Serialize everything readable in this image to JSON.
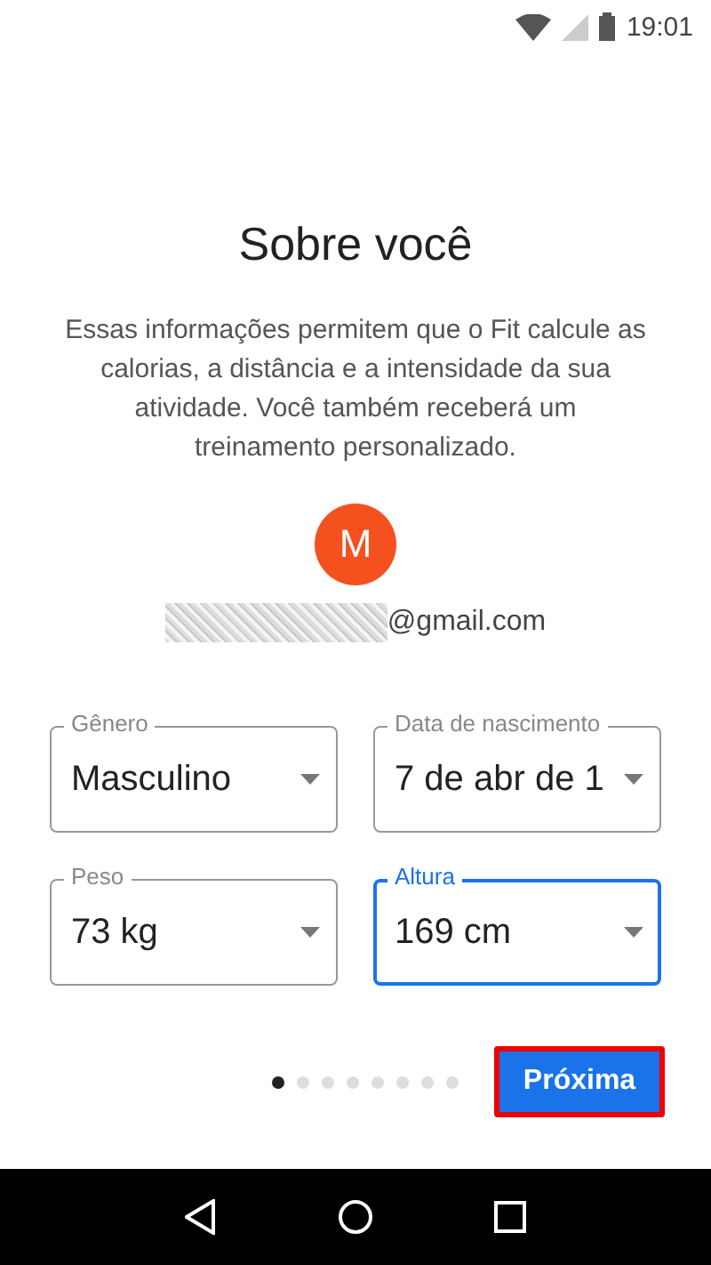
{
  "status_bar": {
    "time": "19:01"
  },
  "title": "Sobre você",
  "description": "Essas informações permitem que o Fit calcule as calorias, a distância e a intensidade da sua atividade. Você também receberá um treinamento personalizado.",
  "account": {
    "initial": "M",
    "color": "#f4511e",
    "email_suffix": "@gmail.com"
  },
  "fields": [
    {
      "label": "Gênero",
      "value": "Masculino",
      "focused": false
    },
    {
      "label": "Data de nascimento",
      "value": "7 de abr de 1",
      "focused": false
    },
    {
      "label": "Peso",
      "value": "73 kg",
      "focused": false
    },
    {
      "label": "Altura",
      "value": "169 cm",
      "focused": true
    }
  ],
  "pages": [
    {
      "selected": true
    },
    {
      "selected": false
    },
    {
      "selected": false
    },
    {
      "selected": false
    },
    {
      "selected": false
    },
    {
      "selected": false
    },
    {
      "selected": false
    },
    {
      "selected": false
    }
  ],
  "next_button": {
    "label": "Próxima",
    "highlighted": true
  }
}
